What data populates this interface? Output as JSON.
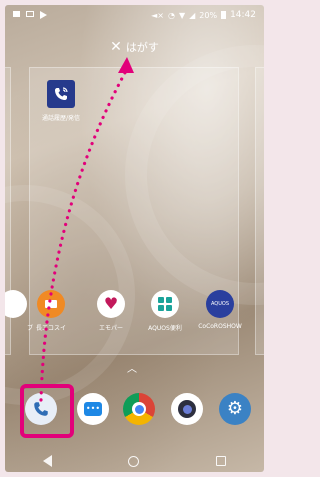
{
  "status_bar": {
    "battery_text": "20%",
    "time": "14:42"
  },
  "remove_bar": {
    "label": "はがす"
  },
  "widget": {
    "label": "通話履歴/発信"
  },
  "app_row": [
    {
      "label": "ブ",
      "icon": "partial-app-icon",
      "color": "#ffffff"
    },
    {
      "label": "長エコスイ",
      "icon": "battery-eco-icon",
      "color": "#f08a24"
    },
    {
      "label": "エモパー",
      "icon": "emopa-heart-icon",
      "color": "#ffffff"
    },
    {
      "label": "AQUOS便利",
      "icon": "aquos-grid-icon",
      "color": "#ffffff"
    },
    {
      "label": "CoCoROSHOW",
      "icon": "aquos-icon",
      "color": "#2a3f9e"
    }
  ],
  "dock": [
    {
      "name": "phone",
      "icon": "phone-icon",
      "color": "#e8eef7"
    },
    {
      "name": "messages",
      "icon": "message-icon",
      "color": "#ffffff"
    },
    {
      "name": "chrome",
      "icon": "chrome-icon",
      "color": "#ffffff"
    },
    {
      "name": "camera",
      "icon": "camera-icon",
      "color": "#ffffff"
    },
    {
      "name": "settings",
      "icon": "settings-gear-icon",
      "color": "#3b82c4"
    }
  ],
  "colors": {
    "highlight": "#e2007a",
    "arrow": "#e2007a"
  },
  "navigation": {
    "icons": [
      "back-icon",
      "home-icon",
      "recents-icon"
    ]
  }
}
